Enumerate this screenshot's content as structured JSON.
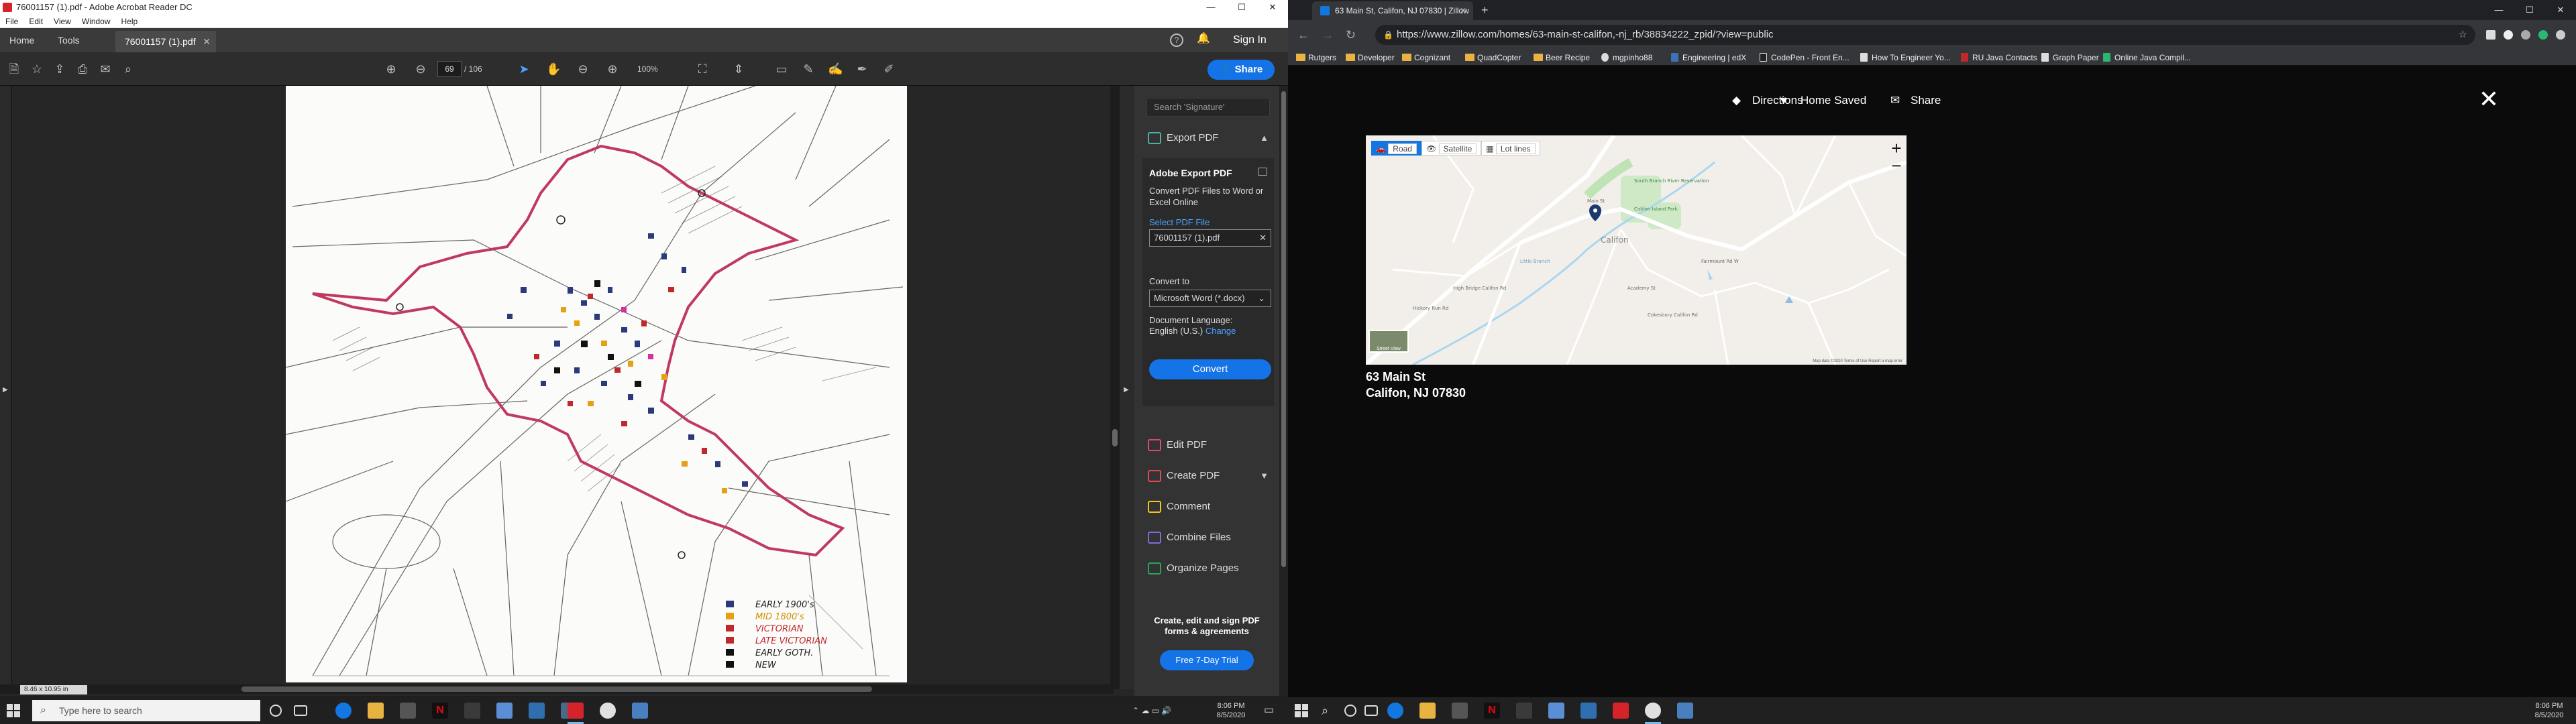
{
  "acrobat": {
    "title": "76001157 (1).pdf - Adobe Acrobat Reader DC",
    "win_controls": [
      "—",
      "☐",
      "✕"
    ],
    "menu": [
      "File",
      "Edit",
      "View",
      "Window",
      "Help"
    ],
    "tabs": {
      "home": "Home",
      "tools": "Tools",
      "doc": "76001157 (1).pdf",
      "close": "✕"
    },
    "sign_in": "Sign In",
    "page_num": "69",
    "page_total": "/ 106",
    "zoom": "100%",
    "share": "Share",
    "page_size": "8.46 x 10.95 in",
    "pane": {
      "search_placeholder": "Search 'Signature'",
      "export_header": "Export PDF",
      "panel_title": "Adobe Export PDF",
      "panel_desc": "Convert PDF Files to Word or Excel Online",
      "select_file": "Select PDF File",
      "file_name": "76001157 (1).pdf",
      "convert_to": "Convert to",
      "format": "Microsoft Word (*.docx)",
      "doc_lang": "Document Language:",
      "lang": "English (U.S.)",
      "change": "Change",
      "convert": "Convert",
      "tools": [
        {
          "label": "Edit PDF",
          "color": "#e0457b"
        },
        {
          "label": "Create PDF",
          "color": "#e34850"
        },
        {
          "label": "Comment",
          "color": "#f5c518"
        },
        {
          "label": "Combine Files",
          "color": "#7c6dd6"
        },
        {
          "label": "Organize Pages",
          "color": "#26a65b"
        }
      ],
      "promo": "Create, edit and sign PDF forms & agreements",
      "trial": "Free 7-Day Trial"
    },
    "legend": [
      "EARLY 1900's",
      "MID 1800's",
      "VICTORIAN",
      "LATE VICTORIAN",
      "EARLY GOTH.",
      "NEW"
    ]
  },
  "taskbar": {
    "search_placeholder": "Type here to search",
    "time": "8:06 PM",
    "date": "8/5/2020"
  },
  "chrome": {
    "tab_title": "63 Main St, Califon, NJ 07830 | Zillow",
    "url": "https://www.zillow.com/homes/63-main-st-califon,-nj_rb/38834222_zpid/?view=public",
    "bookmarks": [
      "Rutgers",
      "Developer",
      "Cognizant",
      "QuadCopter",
      "Beer Recipe",
      "mgpinho88",
      "Engineering | edX",
      "CodePen - Front En...",
      "How To Engineer Yo...",
      "RU Java Contacts",
      "Graph Paper",
      "Online Java Compil..."
    ]
  },
  "zillow": {
    "directions": "Directions",
    "home_saved": "Home Saved",
    "share": "Share",
    "map_types": [
      "Road",
      "Satellite",
      "Lot lines"
    ],
    "street_view": "Street View",
    "map_footer": "Map data ©2020    Terms of Use    Report a map error",
    "map_labels": {
      "reservation": "South Branch River Reservation",
      "park": "Califon Island Park",
      "town": "Califon",
      "academy": "Academy St",
      "fairmount": "Fairmount Rd W",
      "hbc": "High Bridge Califon Rd",
      "cokesbury": "Cokesbury Califon Rd",
      "hickory": "Hickory Run Rd",
      "main": "Main St",
      "river": "Little Branch"
    },
    "address_line1": "63 Main St",
    "address_line2": "Califon, NJ 07830"
  }
}
